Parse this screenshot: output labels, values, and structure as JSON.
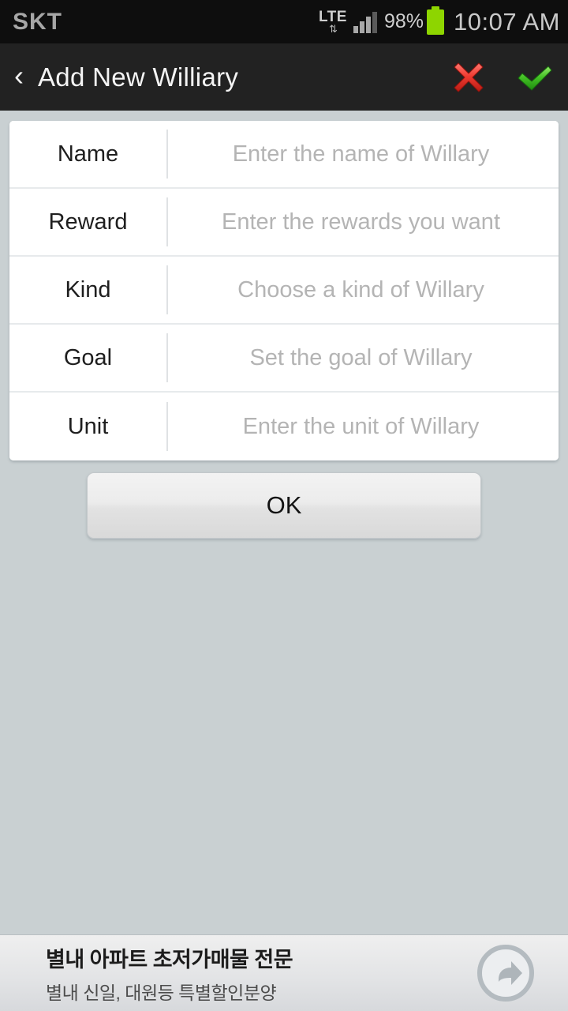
{
  "statusbar": {
    "carrier": "SKT",
    "network": "LTE",
    "network_arrows": "⇅",
    "battery_percent": "98%",
    "clock": "10:07 AM",
    "signal_bars_total": 4,
    "signal_bars_filled": 3,
    "battery_color": "#8ed500"
  },
  "titlebar": {
    "back_label": "‹",
    "title": "Add New Williary",
    "cancel_label": "cancel-icon",
    "confirm_label": "confirm-icon",
    "cancel_color": "#e8392e",
    "confirm_color": "#4fc52b",
    "background": "#222222"
  },
  "form": {
    "rows": [
      {
        "label": "Name",
        "placeholder": "Enter the name of Willary"
      },
      {
        "label": "Reward",
        "placeholder": "Enter the rewards you want"
      },
      {
        "label": "Kind",
        "placeholder": "Choose a kind of Willary"
      },
      {
        "label": "Goal",
        "placeholder": "Set the goal of Willary"
      },
      {
        "label": "Unit",
        "placeholder": "Enter the unit of Willary"
      }
    ]
  },
  "actions": {
    "ok_label": "OK"
  },
  "ad": {
    "title": "별내 아파트 초저가매물 전문",
    "subtitle": "별내 신일, 대원등 특별할인분양",
    "arrow_label": "share-arrow-icon"
  },
  "theme": {
    "page_background": "#c9d0d2",
    "card_background": "#ffffff",
    "placeholder_color": "#b4b4b4",
    "label_color": "#1e1e1e"
  }
}
